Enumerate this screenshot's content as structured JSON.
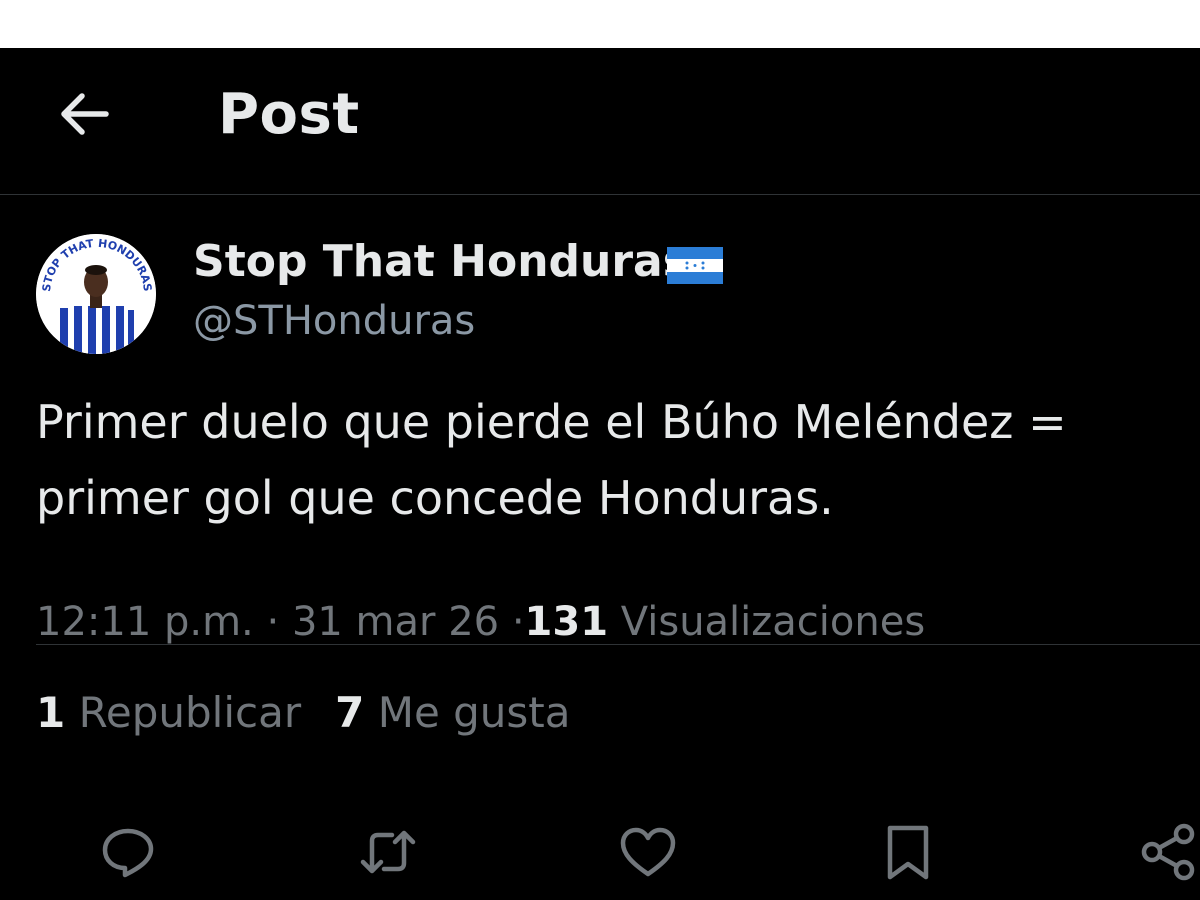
{
  "header": {
    "title": "Post",
    "back_icon": "arrow-left-icon"
  },
  "post": {
    "author": {
      "name": "Stop That Honduras",
      "handle": "@STHonduras",
      "flag_icon": "honduras-flag-icon",
      "avatar_text": "STOP THAT HONDURAS"
    },
    "text_lines": [
      "Primer duelo que pierde el Búho Meléndez =",
      "primer gol que concede Honduras."
    ],
    "meta": {
      "time": "12:11 p.m.",
      "separator": "·",
      "date": "31 mar 26",
      "views_count": "131",
      "views_label": "Visualizaciones"
    },
    "stats": {
      "reposts_count": "1",
      "reposts_label": "Republicar",
      "likes_count": "7",
      "likes_label": "Me gusta"
    },
    "actions": [
      "reply-icon",
      "repost-icon",
      "like-icon",
      "bookmark-icon",
      "share-icon"
    ]
  },
  "colors": {
    "background": "#000000",
    "text_primary": "#e7e9ea",
    "text_secondary": "#71767b",
    "divider": "#2f3336",
    "flag_blue": "#2b7dd6"
  }
}
